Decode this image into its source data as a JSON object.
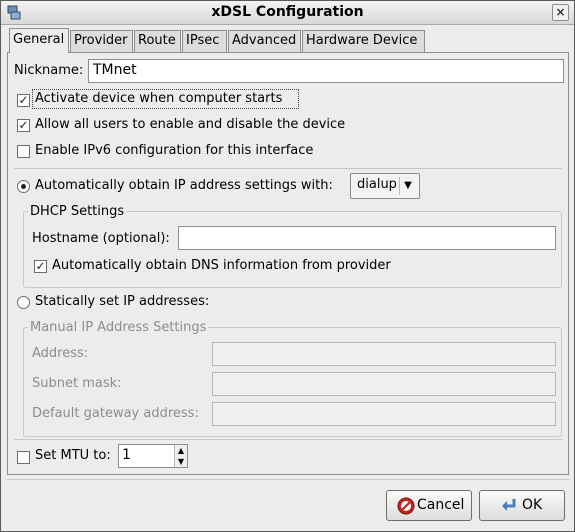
{
  "window": {
    "title": "xDSL Configuration",
    "close_glyph": "×"
  },
  "tabs": [
    {
      "label": "General",
      "active": true
    },
    {
      "label": "Provider",
      "active": false
    },
    {
      "label": "Route",
      "active": false
    },
    {
      "label": "IPsec",
      "active": false
    },
    {
      "label": "Advanced",
      "active": false
    },
    {
      "label": "Hardware Device",
      "active": false
    }
  ],
  "general": {
    "nickname_label": "Nickname:",
    "nickname_value": "TMnet",
    "activate_on_start": {
      "label": "Activate device when computer starts",
      "checked": true
    },
    "allow_users": {
      "label": "Allow all users to enable and disable the device",
      "checked": true
    },
    "enable_ipv6": {
      "label": "Enable IPv6 configuration for this interface",
      "checked": false
    },
    "auto_ip": {
      "label": "Automatically obtain IP address settings with:",
      "selected": true
    },
    "auto_ip_method": "dialup",
    "dhcp": {
      "title": "DHCP Settings",
      "hostname_label": "Hostname (optional):",
      "hostname_value": "",
      "auto_dns": {
        "label": "Automatically obtain DNS information from provider",
        "checked": true
      }
    },
    "static_ip": {
      "label": "Statically set IP addresses:",
      "selected": false
    },
    "manual": {
      "title": "Manual IP Address Settings",
      "address_label": "Address:",
      "subnet_label": "Subnet mask:",
      "gateway_label": "Default gateway address:"
    },
    "mtu": {
      "label": "Set MTU to:",
      "checked": false,
      "value": "1"
    }
  },
  "buttons": {
    "cancel": "Cancel",
    "ok": "OK"
  },
  "colors": {
    "background": "#edeceb",
    "cancel_icon": "#c0281f",
    "ok_icon": "#4a7fb5"
  }
}
